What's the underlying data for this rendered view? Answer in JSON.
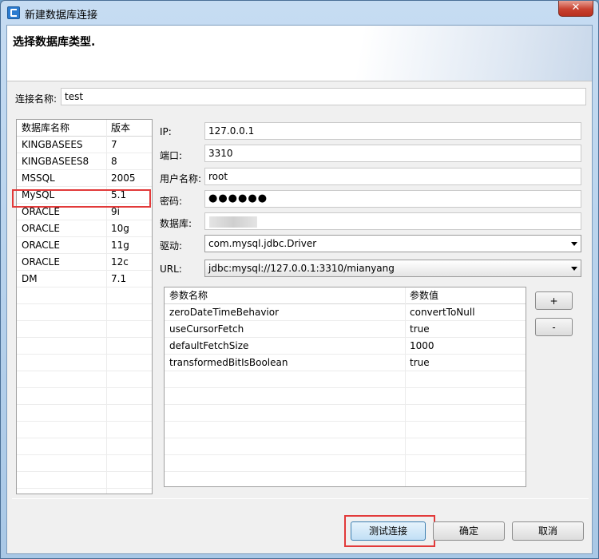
{
  "window": {
    "title": "新建数据库连接",
    "close_glyph": "✕"
  },
  "header": {
    "title": "选择数据库类型."
  },
  "connection_name": {
    "label": "连接名称:",
    "value": "test"
  },
  "db_list": {
    "columns": [
      "数据库名称",
      "版本"
    ],
    "rows": [
      {
        "name": "KINGBASEES",
        "version": "7"
      },
      {
        "name": "KINGBASEES8",
        "version": "8"
      },
      {
        "name": "MSSQL",
        "version": "2005"
      },
      {
        "name": "MySQL",
        "version": "5.1"
      },
      {
        "name": "ORACLE",
        "version": "9i"
      },
      {
        "name": "ORACLE",
        "version": "10g"
      },
      {
        "name": "ORACLE",
        "version": "11g"
      },
      {
        "name": "ORACLE",
        "version": "12c"
      },
      {
        "name": "DM",
        "version": "7.1"
      }
    ],
    "selected_index": 3
  },
  "form": {
    "ip": {
      "label": "IP:",
      "value": "127.0.0.1"
    },
    "port": {
      "label": "端口:",
      "value": "3310"
    },
    "username": {
      "label": "用户名称:",
      "value": "root"
    },
    "password": {
      "label": "密码:",
      "value": "●●●●●●"
    },
    "database": {
      "label": "数据库:"
    },
    "driver": {
      "label": "驱动:",
      "value": "com.mysql.jdbc.Driver"
    },
    "url": {
      "label": "URL:",
      "value": "jdbc:mysql://127.0.0.1:3310/mianyang"
    }
  },
  "params": {
    "columns": [
      "参数名称",
      "参数值"
    ],
    "rows": [
      {
        "name": "zeroDateTimeBehavior",
        "value": "convertToNull"
      },
      {
        "name": "useCursorFetch",
        "value": "true"
      },
      {
        "name": "defaultFetchSize",
        "value": "1000"
      },
      {
        "name": "transformedBitIsBoolean",
        "value": "true"
      }
    ]
  },
  "param_buttons": {
    "add": "+",
    "remove": "-"
  },
  "footer": {
    "test": "测试连接",
    "ok": "确定",
    "cancel": "取消"
  },
  "colors": {
    "highlight": "#e23a3a",
    "accent": "#3c7fb1"
  }
}
